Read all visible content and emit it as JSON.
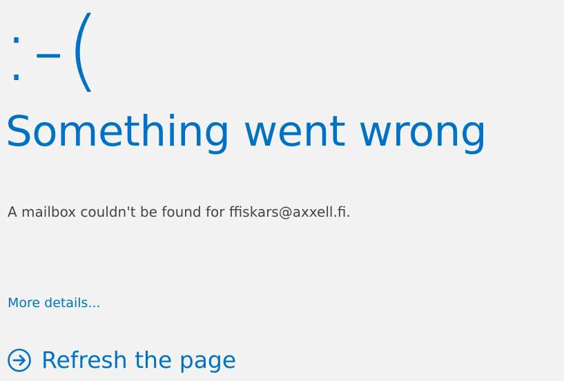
{
  "error": {
    "emoticon": ":-(",
    "title": "Something went wrong",
    "message": "A mailbox couldn't be found for ffiskars@axxell.fi.",
    "details_link": "More details...",
    "refresh_label": "Refresh the page"
  },
  "icons": {
    "refresh": "arrow-circle-right-icon"
  },
  "colors": {
    "background": "#f3f3f3",
    "accent": "#0072c6",
    "body_text": "#444444"
  }
}
